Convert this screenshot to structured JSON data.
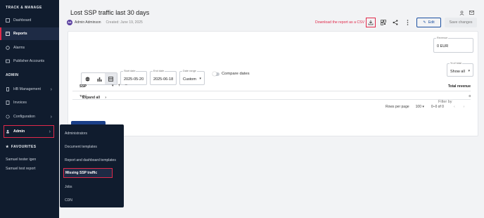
{
  "sidebar": {
    "section_track": "TRACK & MANAGE",
    "items_track": [
      {
        "label": "Dashboard",
        "icon": "dashboard-icon"
      },
      {
        "label": "Reports",
        "icon": "report-icon"
      },
      {
        "label": "Alarms",
        "icon": "alarm-icon"
      },
      {
        "label": "Publisher Accounts",
        "icon": "publisher-icon"
      }
    ],
    "section_admin": "ADMIN",
    "items_admin": [
      {
        "label": "HB Management",
        "icon": "hb-icon"
      },
      {
        "label": "Invoices",
        "icon": "invoice-icon"
      },
      {
        "label": "Configuration",
        "icon": "gear-icon"
      },
      {
        "label": "Admin",
        "icon": "admin-icon"
      }
    ],
    "section_fav": "FAVOURITES",
    "favourites": [
      "Samuel tester igen",
      "Samuel test report"
    ]
  },
  "flyout": {
    "items": [
      "Administrators",
      "Document templates",
      "Report and dashboard templates",
      "Missing SSP traffic",
      "Jobs",
      "CDN"
    ]
  },
  "report": {
    "title": "Lost SSP traffic last 30 days",
    "avatar_initials": "AA",
    "author": "Admin Adminson",
    "created": "Created: June 19, 2025",
    "download_link": "Download the report as a CSV",
    "edit_label": "Edit",
    "save_label": "Save changes"
  },
  "controls": {
    "start_label": "Start date",
    "start_value": "2025-05-20",
    "end_label": "End date",
    "end_value": "2025-06-18",
    "range_label": "Date range",
    "range_value": "Custom",
    "compare_label": "Compare dates",
    "revenue_label": "Revenue",
    "revenue_value": "0 EUR",
    "expand_all": "Expand all",
    "filter_by": "Filter by",
    "total_filter_label": "% of total",
    "total_filter_value": "Show all"
  },
  "table": {
    "col_ssp": "SSP",
    "col_revenue": "Total revenue",
    "row_total_label": "Total",
    "row_total_value": "0"
  },
  "pager": {
    "rows_label": "Rows per page",
    "rows_value": "100",
    "range": "0–0 of 0"
  },
  "colors": {
    "accent": "#e0294a",
    "sidebar": "#101c2e",
    "primary": "#1a4fa0"
  }
}
